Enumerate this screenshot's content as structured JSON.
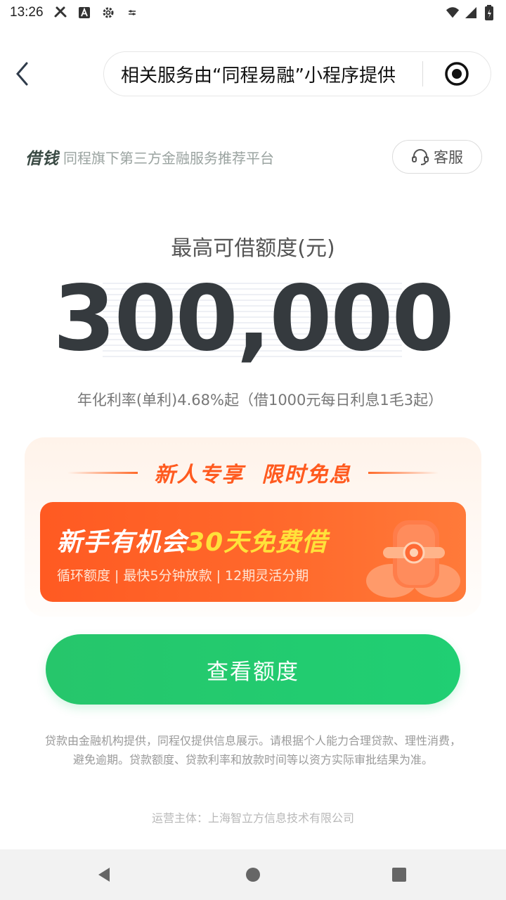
{
  "status_bar": {
    "time": "13:26",
    "left_icons": [
      "tools-icon",
      "a-icon",
      "gear-icon",
      "signal-small-icon"
    ],
    "right_icons": [
      "wifi-icon",
      "signal-icon",
      "battery-icon"
    ]
  },
  "top_bar": {
    "capsule_text": "相关服务由“同程易融”小程序提供"
  },
  "header": {
    "brand_logo": "借钱",
    "brand_desc": "同程旗下第三方金融服务推荐平台",
    "service_label": "客服"
  },
  "limit": {
    "title": "最高可借额度(元)",
    "amount": "300,000",
    "rate_text": "年化利率(单利)4.68%起（借1000元每日利息1毛3起）"
  },
  "promo": {
    "head_text": "新人专享  限时免息",
    "banner_main_prefix": "新手有机会",
    "banner_main_highlight": "30天免费借",
    "banner_sub": "循环额度 | 最快5分钟放款 | 12期灵活分期"
  },
  "cta": {
    "label": "查看额度"
  },
  "footer": {
    "disclaimer": "贷款由金融机构提供，同程仅提供信息展示。请根据个人能力合理贷款、理性消费，避免逾期。贷款额度、贷款利率和放款时间等以资方实际审批结果为准。",
    "operator": "运营主体：上海智立方信息技术有限公司"
  },
  "colors": {
    "accent_green": "#22c96f",
    "promo_orange": "#ff5a22",
    "highlight_yellow": "#ffe13a"
  }
}
